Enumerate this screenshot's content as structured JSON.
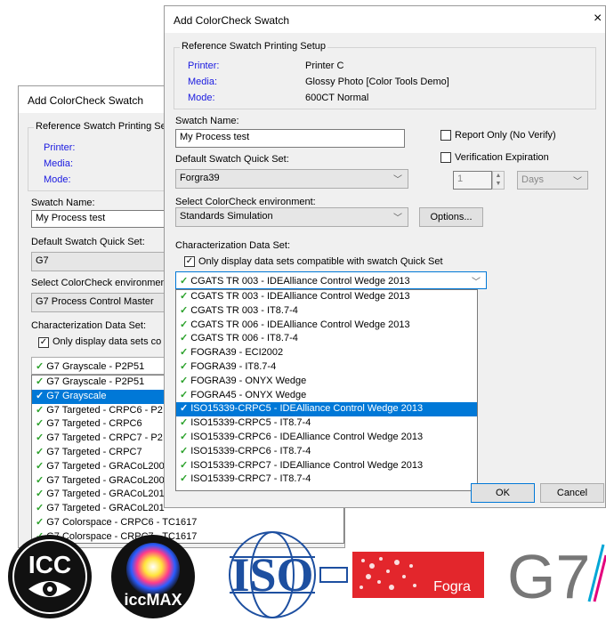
{
  "back": {
    "title": "Add ColorCheck Swatch",
    "ref_group": "Reference Swatch Printing Se",
    "printer_label": "Printer:",
    "media_label": "Media:",
    "mode_label": "Mode:",
    "swatch_name_label": "Swatch Name:",
    "swatch_name_value": "My Process test",
    "quickset_label": "Default Swatch Quick Set:",
    "quickset_value": "G7",
    "env_label": "Select ColorCheck environment",
    "env_value": "G7 Process Control Master",
    "charset_label": "Characterization Data Set:",
    "only_display": "Only display data sets co",
    "selected": "G7 Grayscale - P2P51",
    "list": [
      "G7 Grayscale - P2P51",
      "G7 Grayscale",
      "G7 Targeted - CRPC6 - P2",
      "G7 Targeted - CRPC6",
      "G7 Targeted - CRPC7 - P2",
      "G7 Targeted - CRPC7",
      "G7 Targeted - GRACoL200",
      "G7 Targeted - GRACoL200",
      "G7 Targeted - GRACoL201",
      "G7 Targeted - GRACoL201",
      "G7 Colorspace - CRPC6 - TC1617",
      "G7 Colorspace - CRPC7 - TC1617"
    ],
    "highlight_index": 1
  },
  "front": {
    "title": "Add ColorCheck Swatch",
    "close": "×",
    "ref_group": "Reference Swatch Printing Setup",
    "printer_label": "Printer:",
    "printer_value": "Printer C",
    "media_label": "Media:",
    "media_value": "Glossy Photo [Color Tools Demo]",
    "mode_label": "Mode:",
    "mode_value": "600CT Normal",
    "swatch_name_label": "Swatch Name:",
    "swatch_name_value": "My Process test",
    "report_only": "Report Only (No Verify)",
    "verification_expiration": "Verification Expiration",
    "exp_number": "1",
    "exp_unit": "Days",
    "quickset_label": "Default Swatch Quick Set:",
    "quickset_value": "Forgra39",
    "env_label": "Select ColorCheck environment:",
    "env_value": "Standards Simulation",
    "options_button": "Options...",
    "charset_label": "Characterization Data Set:",
    "only_display": "Only display data sets compatible with swatch Quick Set",
    "selected": "CGATS TR 003 - IDEAlliance Control Wedge 2013",
    "list": [
      "CGATS TR 003 - IDEAlliance Control Wedge 2013",
      "CGATS TR 003 - IT8.7-4",
      "CGATS TR 006 - IDEAlliance Control Wedge 2013",
      "CGATS TR 006 - IT8.7-4",
      "FOGRA39 - ECI2002",
      "FOGRA39 - IT8.7-4",
      "FOGRA39 - ONYX Wedge",
      "FOGRA45 - ONYX Wedge",
      "ISO15339-CRPC5 - IDEAlliance Control Wedge 2013",
      "ISO15339-CRPC5 - IT8.7-4",
      "ISO15339-CRPC6 - IDEAlliance Control Wedge 2013",
      "ISO15339-CRPC6 - IT8.7-4",
      "ISO15339-CRPC7 - IDEAlliance Control Wedge 2013",
      "ISO15339-CRPC7 - IT8.7-4"
    ],
    "highlight_index": 8,
    "ok_button": "OK",
    "cancel_button": "Cancel"
  },
  "logos": {
    "icc": "ICC",
    "iccmax": "iccMAX",
    "iso": "ISO",
    "fogra": "Fogra",
    "g7": "G7"
  },
  "colors": {
    "selection": "#0078d7",
    "label_blue": "#1a1ae0",
    "check_green": "#2aa12a",
    "fogra_red": "#e3262c"
  }
}
